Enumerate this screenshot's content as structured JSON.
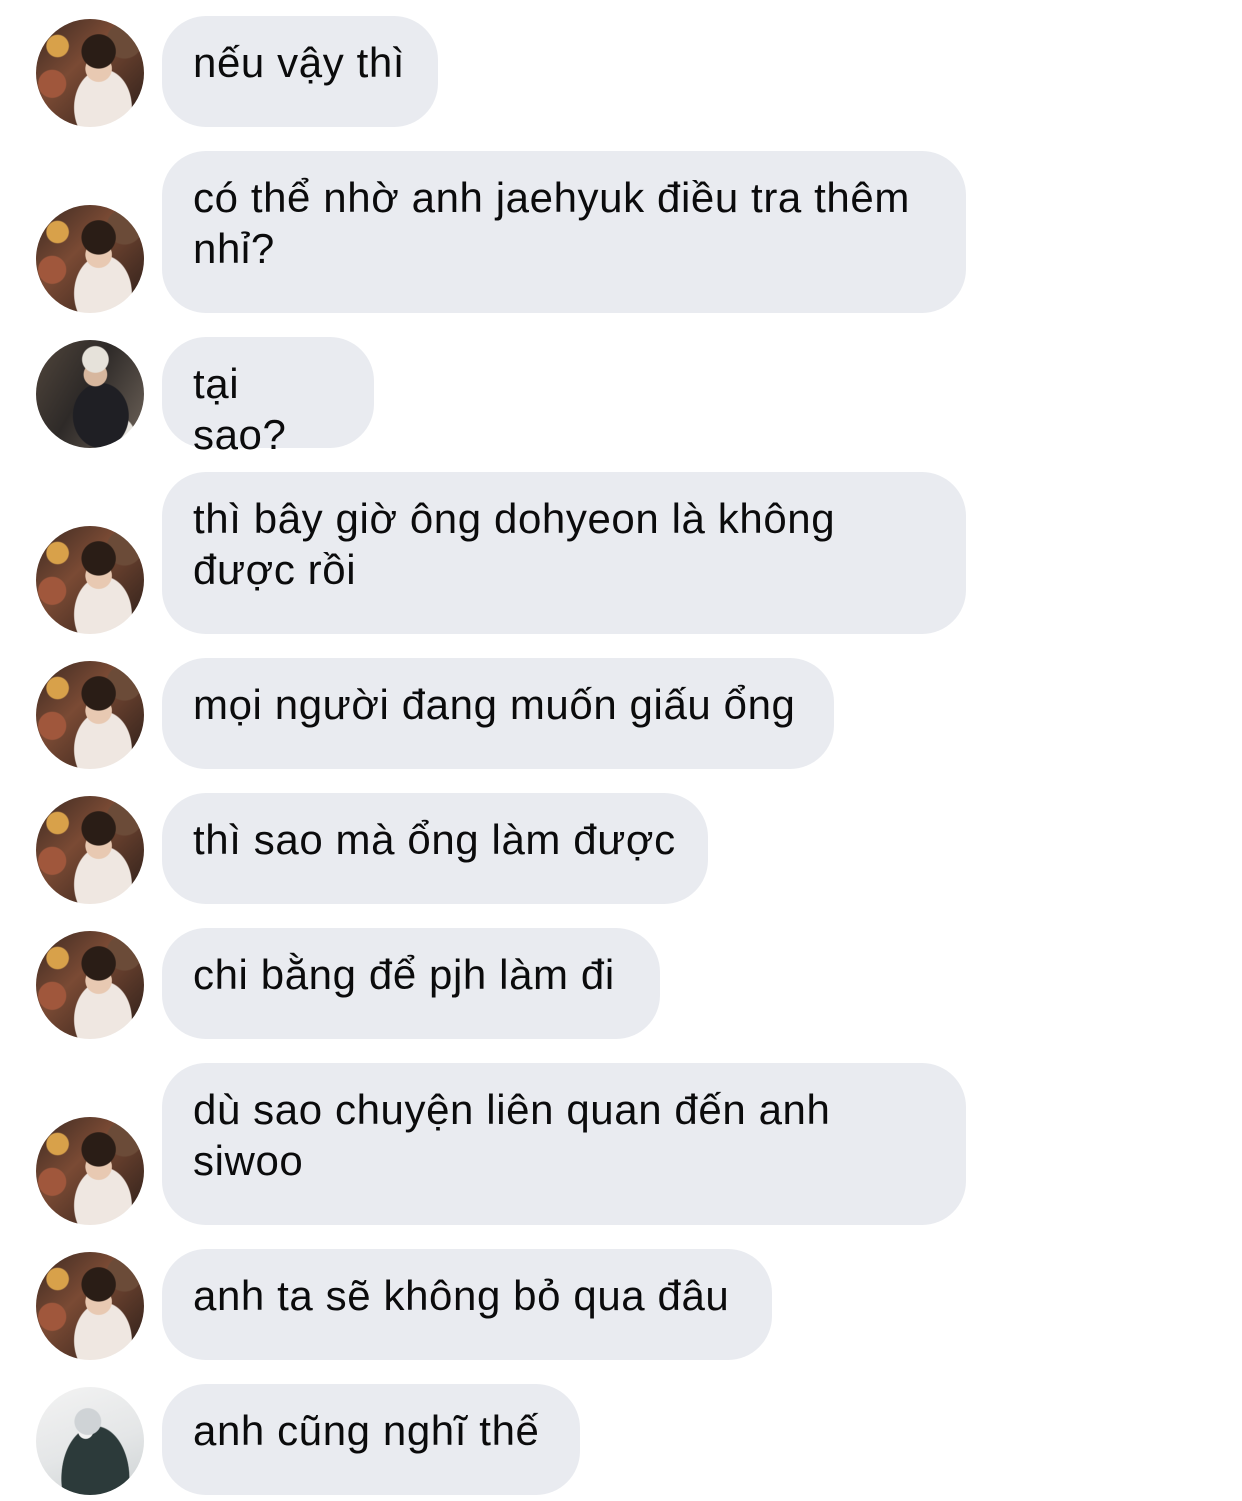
{
  "messages": [
    {
      "sender": "user-a",
      "text": "nếu vậy thì"
    },
    {
      "sender": "user-a",
      "text": "có thể nhờ anh jaehyuk điều tra thêm\nnhỉ?"
    },
    {
      "sender": "user-b",
      "text": "tại sao?"
    },
    {
      "sender": "user-a",
      "text": "thì bây giờ ông dohyeon là không\nđược rồi"
    },
    {
      "sender": "user-a",
      "text": "mọi người đang muốn giấu ổng"
    },
    {
      "sender": "user-a",
      "text": "thì sao mà ổng làm được"
    },
    {
      "sender": "user-a",
      "text": "chi bằng để pjh làm đi"
    },
    {
      "sender": "user-a",
      "text": "dù sao chuyện liên quan đến anh\nsiwoo"
    },
    {
      "sender": "user-a",
      "text": "anh ta sẽ không bỏ qua đâu"
    },
    {
      "sender": "user-c",
      "text": "anh cũng nghĩ thế"
    }
  ],
  "colors": {
    "bubble_background": "#e9ebf0",
    "text": "#0b0b0c",
    "page_background": "#ffffff"
  }
}
